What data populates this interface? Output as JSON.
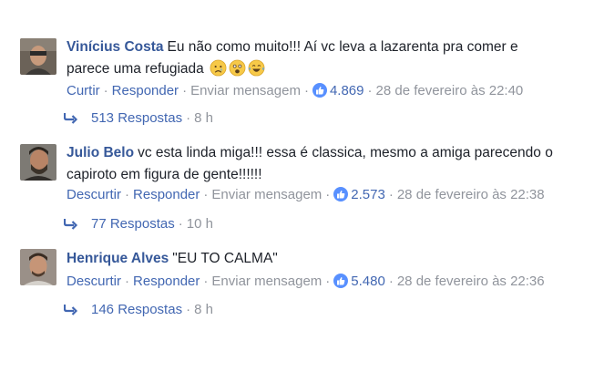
{
  "comments": [
    {
      "author": "Vinícius Costa",
      "text_line1": "Eu não como muito!!! Aí vc leva a lazarenta pra comer e",
      "text_line2": "parece uma refugiada",
      "emojis": [
        "crying-face-icon",
        "fearful-face-icon",
        "tears-of-joy-icon"
      ],
      "like_label": "Curtir",
      "reply_label": "Responder",
      "message_label": "Enviar mensagem",
      "likes": "4.869",
      "date": "28 de fevereiro às 22:40",
      "replies": "513 Respostas",
      "replies_age": "8 h"
    },
    {
      "author": "Julio Belo",
      "text_line1": "vc esta linda miga!!! essa é classica, mesmo a amiga parecendo o",
      "text_line2": "capiroto em figura de gente!!!!!!",
      "like_label": "Descurtir",
      "reply_label": "Responder",
      "message_label": "Enviar mensagem",
      "likes": "2.573",
      "date": "28 de fevereiro às 22:38",
      "replies": "77 Respostas",
      "replies_age": "10 h"
    },
    {
      "author": "Henrique Alves",
      "text_line1": "\"EU TO CALMA\"",
      "like_label": "Descurtir",
      "reply_label": "Responder",
      "message_label": "Enviar mensagem",
      "likes": "5.480",
      "date": "28 de fevereiro às 22:36",
      "replies": "146 Respostas",
      "replies_age": "8 h"
    }
  ],
  "separator": "·",
  "colors": {
    "link": "#4267b2",
    "author": "#365899",
    "muted": "#90949c",
    "like_badge": "#5890ff"
  }
}
